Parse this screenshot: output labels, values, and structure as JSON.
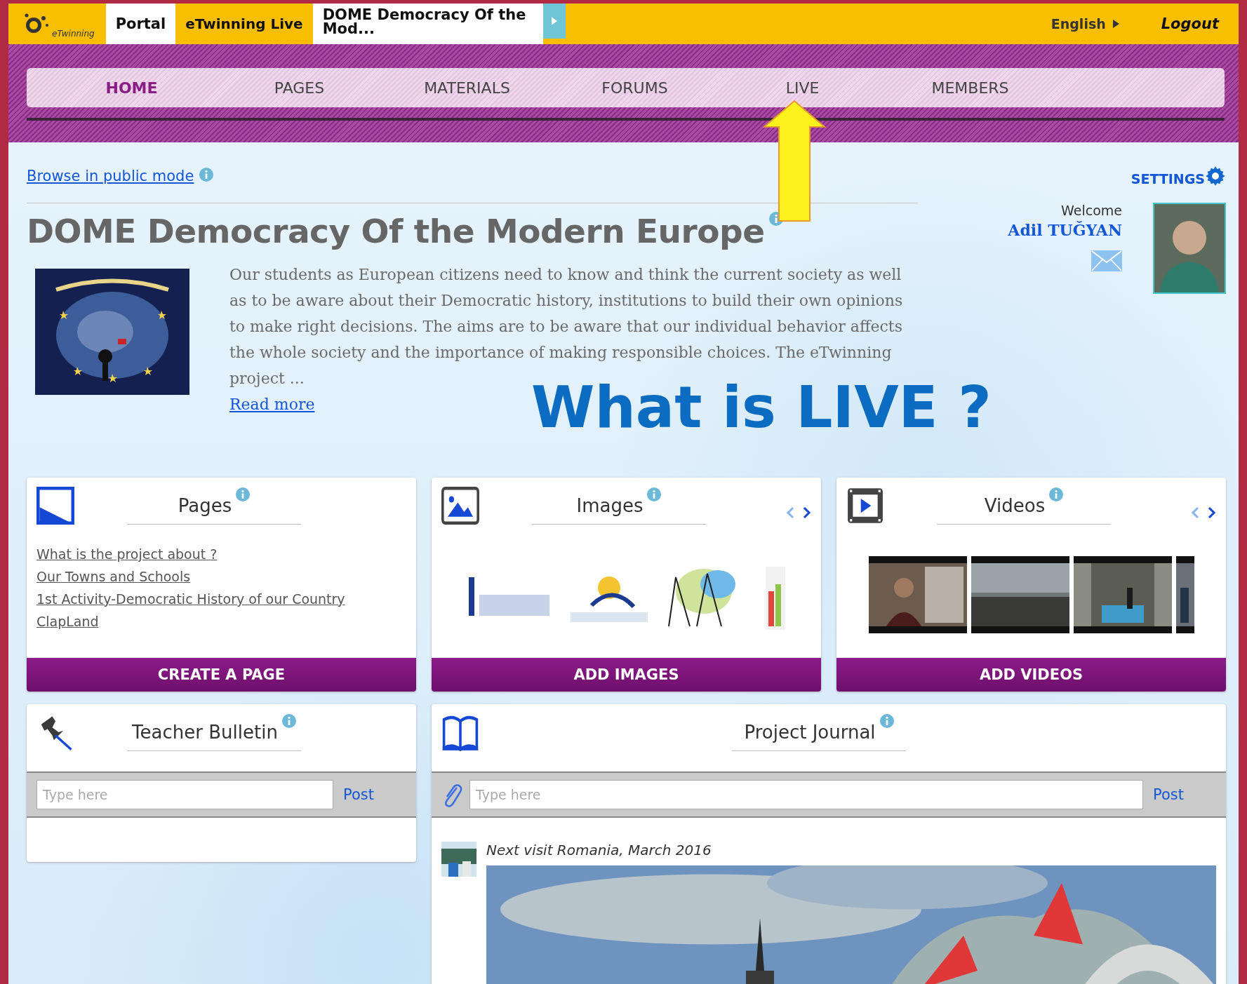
{
  "top_bar": {
    "brand": "eTwinning",
    "tabs": [
      {
        "label": "Portal",
        "selected": false
      },
      {
        "label": "eTwinning Live",
        "selected": true
      },
      {
        "label": "DOME Democracy Of the Mod...",
        "selected": false
      }
    ],
    "language": "English",
    "logout": "Logout"
  },
  "nav": [
    {
      "label": "HOME",
      "selected": true
    },
    {
      "label": "PAGES",
      "selected": false
    },
    {
      "label": "MATERIALS",
      "selected": false
    },
    {
      "label": "FORUMS",
      "selected": false
    },
    {
      "label": "LIVE",
      "selected": false
    },
    {
      "label": "MEMBERS",
      "selected": false
    }
  ],
  "browse_link": "Browse in public mode",
  "settings": "SETTINGS",
  "project": {
    "title": "DOME Democracy Of the Modern Europe",
    "description": "Our students as European citizens need to know and think the current society as well as to be aware about their Democratic history, institutions to build their own opinions to make right decisions. The aims are to be aware that our individual behavior affects the whole society and the importance of making responsible choices. The eTwinning project ...",
    "read_more": "Read more"
  },
  "annotation": "What is LIVE ?",
  "user": {
    "welcome": "Welcome",
    "name": "Adil TUĞYAN"
  },
  "cards": [
    {
      "kind": "pages",
      "title": "Pages",
      "links": [
        "What is the project about ?",
        "Our Towns and Schools",
        "1st Activity-Democratic History of our Country",
        "ClapLand"
      ],
      "action": "CREATE A PAGE"
    },
    {
      "kind": "images",
      "title": "Images",
      "action": "ADD IMAGES"
    },
    {
      "kind": "videos",
      "title": "Videos",
      "action": "ADD VIDEOS"
    }
  ],
  "bulletin": {
    "title": "Teacher Bulletin",
    "placeholder": "Type here",
    "post": "Post"
  },
  "journal": {
    "title": "Project Journal",
    "placeholder": "Type here",
    "post": "Post",
    "entries": [
      {
        "caption": "Next visit Romania, March 2016"
      }
    ]
  }
}
